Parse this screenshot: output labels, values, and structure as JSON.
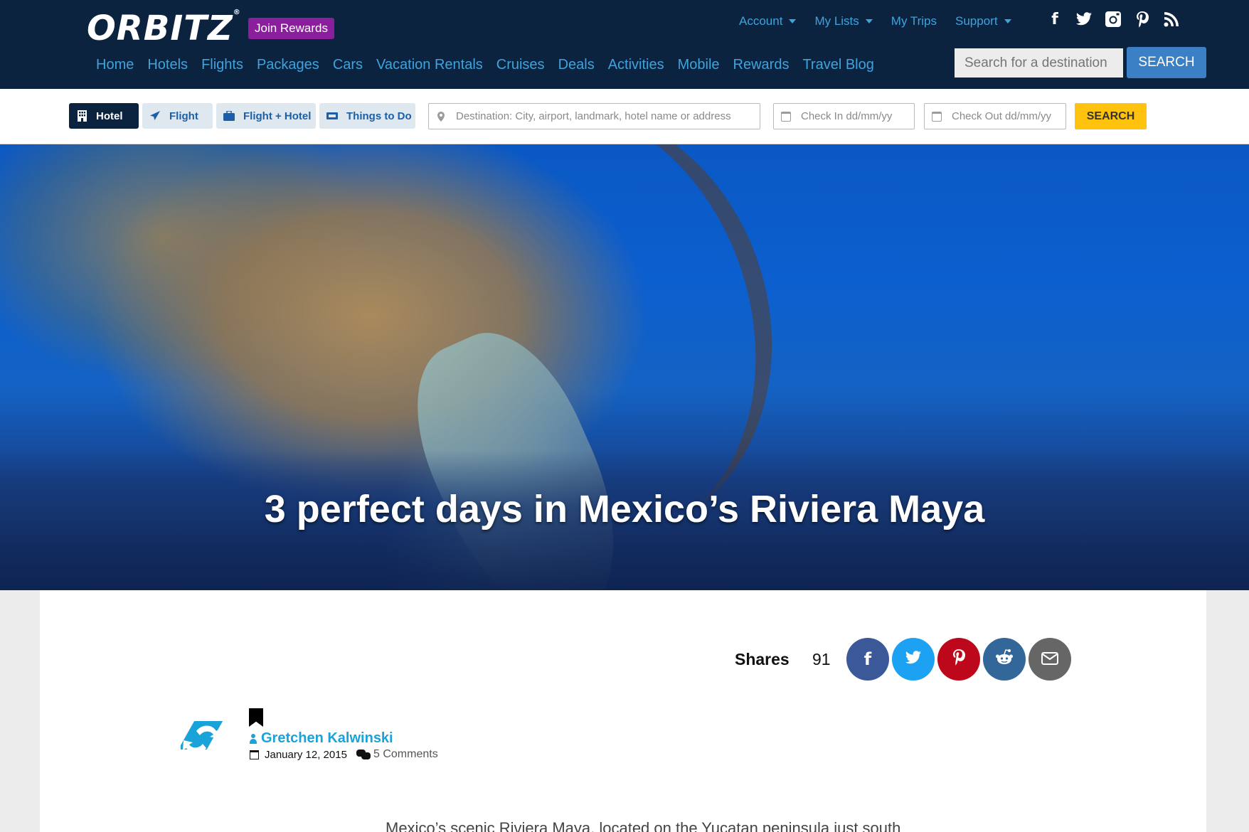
{
  "header": {
    "logo_text": "ORBITZ",
    "join_rewards_label": "Join Rewards",
    "util_nav": [
      {
        "label": "Account",
        "has_caret": true
      },
      {
        "label": "My Lists",
        "has_caret": true
      },
      {
        "label": "My Trips",
        "has_caret": false
      },
      {
        "label": "Support",
        "has_caret": true
      }
    ],
    "social_icons": [
      "facebook-icon",
      "twitter-icon",
      "instagram-icon",
      "pinterest-icon",
      "rss-icon"
    ],
    "main_nav": [
      "Home",
      "Hotels",
      "Flights",
      "Packages",
      "Cars",
      "Vacation Rentals",
      "Cruises",
      "Deals",
      "Activities",
      "Mobile",
      "Rewards",
      "Travel Blog"
    ],
    "search_placeholder": "Search for a destination",
    "search_button": "SEARCH"
  },
  "booking": {
    "tabs": [
      {
        "label": "Hotel",
        "icon": "building-icon",
        "active": true
      },
      {
        "label": "Flight",
        "icon": "plane-icon",
        "active": false
      },
      {
        "label": "Flight + Hotel",
        "icon": "suitcase-icon",
        "active": false
      },
      {
        "label": "Things to Do",
        "icon": "ticket-icon",
        "active": false
      }
    ],
    "destination_placeholder": "Destination: City, airport, landmark, hotel name or address",
    "checkin_placeholder": "Check In dd/mm/yy",
    "checkout_placeholder": "Check Out dd/mm/yy",
    "search_button": "SEARCH"
  },
  "hero": {
    "title": "3 perfect days in Mexico’s Riviera Maya"
  },
  "shares": {
    "label": "Shares",
    "count": "91",
    "buttons": [
      {
        "icon": "facebook-icon",
        "color": "#3b5998"
      },
      {
        "icon": "twitter-icon",
        "color": "#1da1f2"
      },
      {
        "icon": "pinterest-icon",
        "color": "#bd081c"
      },
      {
        "icon": "reddit-icon",
        "color": "#336699"
      },
      {
        "icon": "email-icon",
        "color": "#666666"
      }
    ]
  },
  "post": {
    "author": "Gretchen Kalwinski",
    "date": "January 12, 2015",
    "comments": "5 Comments",
    "excerpt": "Mexico’s scenic Riviera Maya, located on the Yucatan peninsula just south"
  },
  "colors": {
    "header_bg": "#0c2340",
    "nav_link": "#3fa3dc",
    "rewards_purple": "#8a1e9c",
    "search_blue": "#3b7fc4",
    "booking_yellow": "#ffc20e",
    "author_blue": "#1aa3d9"
  }
}
